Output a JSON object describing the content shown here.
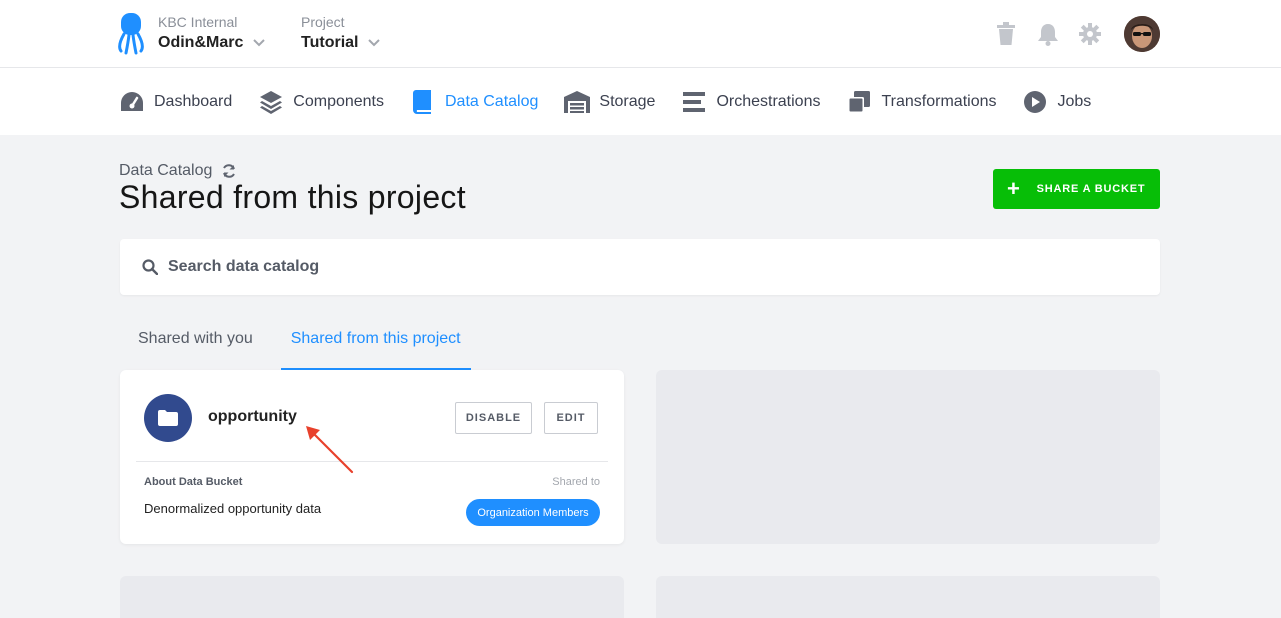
{
  "header": {
    "organization_label": "KBC Internal",
    "organization_name": "Odin&Marc",
    "project_label": "Project",
    "project_name": "Tutorial"
  },
  "nav": {
    "items": [
      {
        "label": "Dashboard",
        "icon": "dashboard-icon",
        "active": false
      },
      {
        "label": "Components",
        "icon": "layers-icon",
        "active": false
      },
      {
        "label": "Data Catalog",
        "icon": "book-icon",
        "active": true
      },
      {
        "label": "Storage",
        "icon": "warehouse-icon",
        "active": false
      },
      {
        "label": "Orchestrations",
        "icon": "bars-icon",
        "active": false
      },
      {
        "label": "Transformations",
        "icon": "copy-icon",
        "active": false
      },
      {
        "label": "Jobs",
        "icon": "play-icon",
        "active": false
      }
    ]
  },
  "page": {
    "breadcrumb": "Data Catalog",
    "title": "Shared from this project",
    "share_button": "SHARE A BUCKET"
  },
  "search": {
    "placeholder": "Search data catalog"
  },
  "tabs": [
    {
      "label": "Shared with you",
      "active": false
    },
    {
      "label": "Shared from this project",
      "active": true
    }
  ],
  "bucket": {
    "name": "opportunity",
    "disable_label": "DISABLE",
    "edit_label": "EDIT",
    "about_label": "About Data Bucket",
    "shared_to_label": "Shared to",
    "description": "Denormalized opportunity data",
    "shared_to": "Organization Members"
  },
  "colors": {
    "accent": "#1f8fff",
    "primary_button": "#07be07",
    "folder_icon_bg": "#314a8e",
    "annotation_arrow": "#e8412c"
  }
}
